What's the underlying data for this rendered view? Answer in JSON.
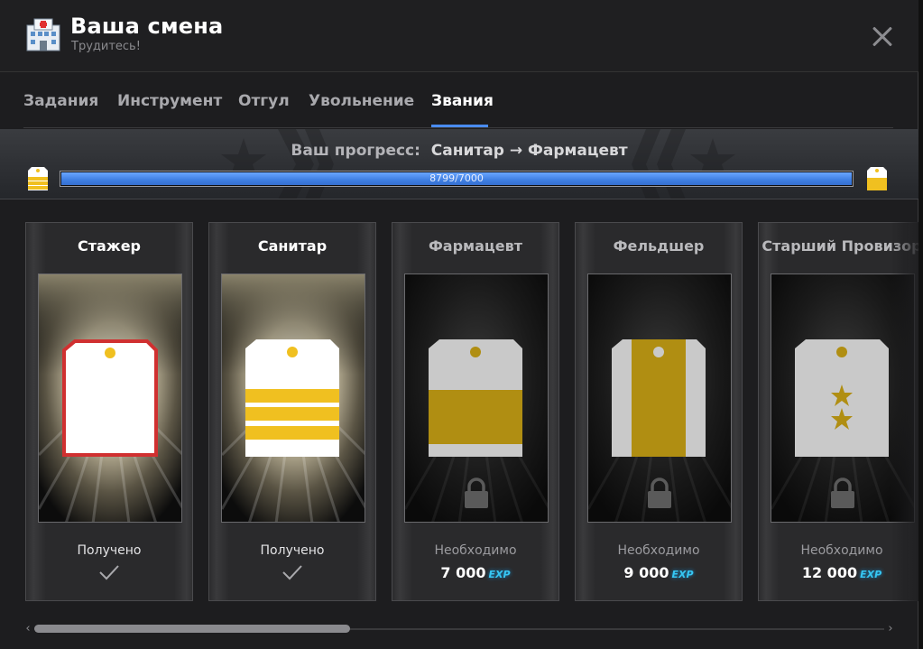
{
  "window": {
    "title": "Ваша смена",
    "subtitle": "Трудитесь!",
    "icon": "hospital-icon"
  },
  "tabs": [
    {
      "label": "Задания",
      "active": false
    },
    {
      "label": "Инструмент",
      "active": false
    },
    {
      "label": "Отгул",
      "active": false
    },
    {
      "label": "Увольнение",
      "active": false
    },
    {
      "label": "Звания",
      "active": true
    }
  ],
  "progress": {
    "label_prefix": "Ваш прогресс:",
    "from_rank": "Санитар",
    "arrow": "→",
    "to_rank": "Фармацевт",
    "current": 8799,
    "target": 7000,
    "text": "8799/7000",
    "fill_fraction": 1.0
  },
  "ranks": [
    {
      "name": "Стажер",
      "status": "Получено",
      "obtained": true,
      "requirement": ""
    },
    {
      "name": "Санитар",
      "status": "Получено",
      "obtained": true,
      "requirement": ""
    },
    {
      "name": "Фармацевт",
      "status": "Необходимо",
      "obtained": false,
      "requirement": "7 000",
      "unit": "EXP"
    },
    {
      "name": "Фельдшер",
      "status": "Необходимо",
      "obtained": false,
      "requirement": "9 000",
      "unit": "EXP"
    },
    {
      "name": "Старший Провизор",
      "status": "Необходимо",
      "obtained": false,
      "requirement": "12 000",
      "unit": "EXP"
    }
  ],
  "colors": {
    "accent": "#4a8cf0",
    "gold": "#f0c020",
    "exp": "#36c6f2"
  },
  "scrollbar": {
    "left_arrow": "‹",
    "right_arrow": "›"
  }
}
